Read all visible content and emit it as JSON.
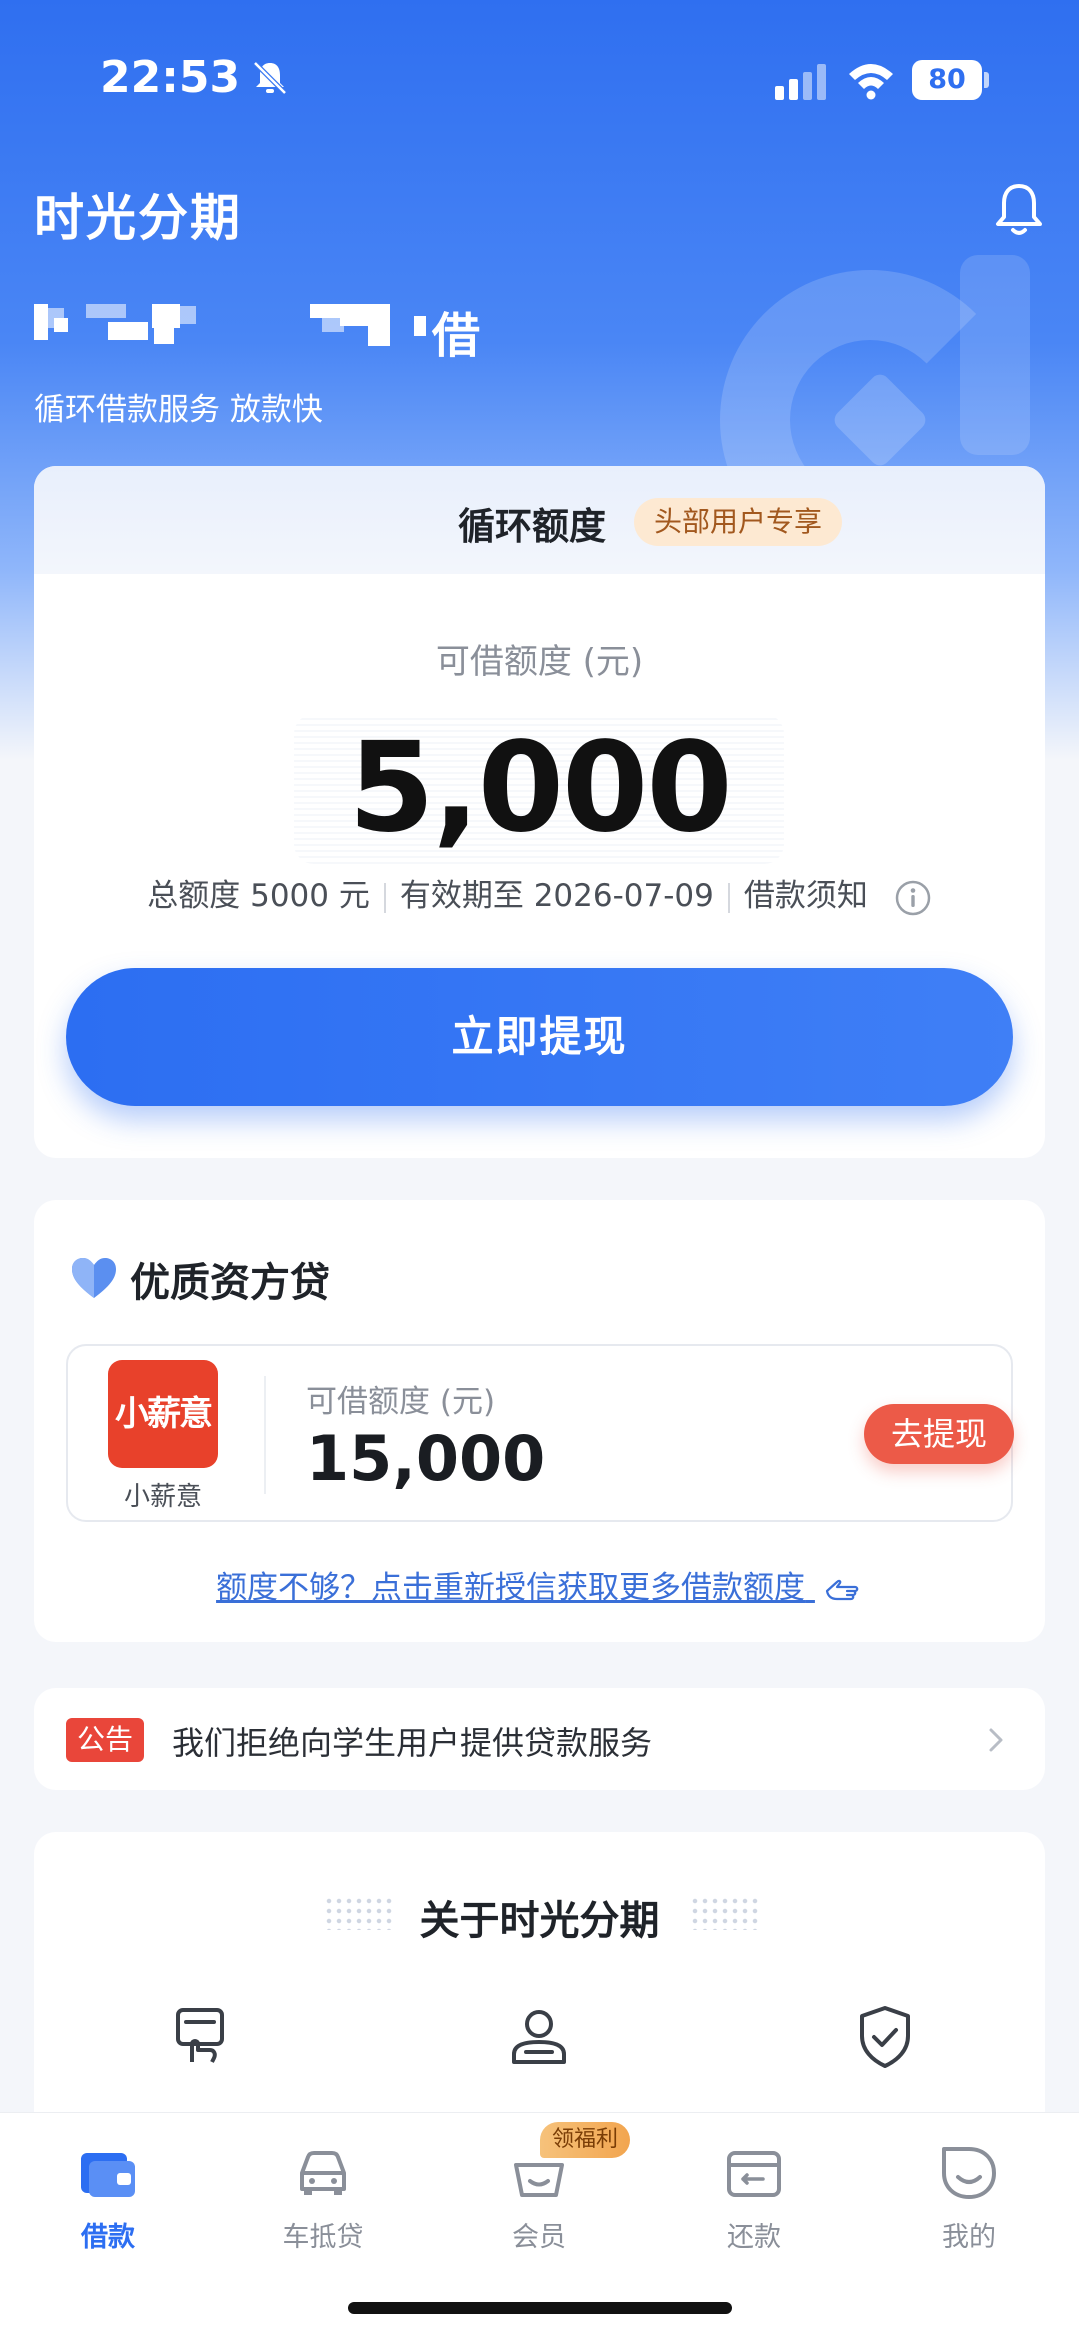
{
  "status_bar": {
    "time": "22:53",
    "battery": "80"
  },
  "header": {
    "app_title": "时光分期",
    "headline_suffix": "借",
    "subtitle": "循环借款服务 放款快"
  },
  "credit_card": {
    "title": "循环额度",
    "badge": "头部用户专享",
    "available_label": "可借额度 (元)",
    "amount": "5,000",
    "total_quota": "总额度 5000 元",
    "valid_until": "有效期至 2026-07-09",
    "loan_notice": "借款须知",
    "cta_label": "立即提现"
  },
  "partner_section": {
    "title": "优质资方贷",
    "partner": {
      "logo_text": "小薪意",
      "name": "小薪意",
      "available_label": "可借额度 (元)",
      "amount": "15,000",
      "button_label": "去提现"
    },
    "more_link": "额度不够？点击重新授信获取更多借款额度"
  },
  "notice": {
    "tag": "公告",
    "text": "我们拒绝向学生用户提供贷款服务"
  },
  "about": {
    "title": "关于时光分期"
  },
  "tabbar": {
    "badge": "领福利",
    "items": [
      {
        "label": "借款",
        "icon": "wallet-icon",
        "active": true
      },
      {
        "label": "车抵贷",
        "icon": "car-icon",
        "active": false
      },
      {
        "label": "会员",
        "icon": "basket-icon",
        "active": false
      },
      {
        "label": "还款",
        "icon": "card-icon",
        "active": false
      },
      {
        "label": "我的",
        "icon": "smile-icon",
        "active": false
      }
    ]
  },
  "colors": {
    "primary": "#2C6EF2",
    "danger": "#E9463A",
    "badge_bg": "#FDE9D2"
  }
}
